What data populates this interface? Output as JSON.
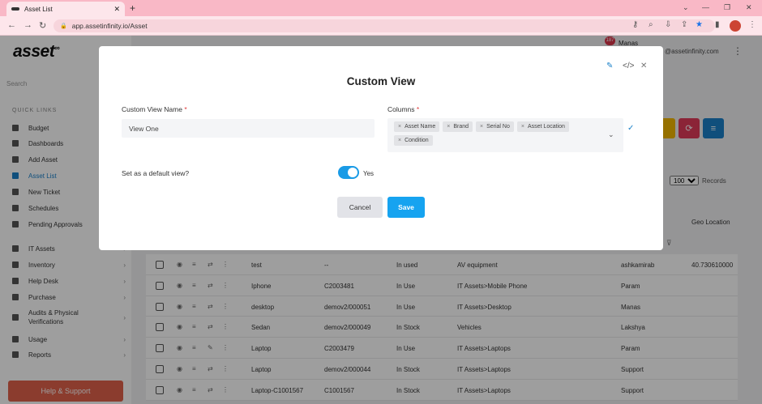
{
  "browser": {
    "tab_title": "Asset List",
    "new_tab": "+",
    "url": "app.assetinfinity.io/Asset"
  },
  "sidebar": {
    "logo": "asset",
    "logo_sup": "∞",
    "search_placeholder": "Search",
    "quick_links_heading": "QUICK LINKS",
    "items": [
      {
        "label": "Budget",
        "icon": "budget-icon"
      },
      {
        "label": "Dashboards",
        "icon": "dashboard-icon"
      },
      {
        "label": "Add Asset",
        "icon": "plus-icon"
      },
      {
        "label": "Asset List",
        "icon": "asset-list-icon",
        "active": true
      },
      {
        "label": "New Ticket",
        "icon": "ticket-icon"
      },
      {
        "label": "Schedules",
        "icon": "calendar-icon"
      },
      {
        "label": "Pending Approvals",
        "icon": "approval-icon"
      },
      {
        "label": "IT Assets",
        "icon": "laptop-icon"
      },
      {
        "label": "Inventory",
        "icon": "inventory-icon"
      },
      {
        "label": "Help Desk",
        "icon": "help-icon"
      },
      {
        "label": "Purchase",
        "icon": "dollar-icon"
      },
      {
        "label": "Audits & Physical Verifications",
        "icon": "audit-icon"
      },
      {
        "label": "Usage",
        "icon": "usage-icon"
      },
      {
        "label": "Reports",
        "icon": "reports-icon"
      }
    ],
    "help_button": "Help & Support"
  },
  "header": {
    "notification_count": "187",
    "user_name": "Manas",
    "user_email": "@assetinfinity.com"
  },
  "list": {
    "records_per_page": "100",
    "records_label": "Records",
    "geo_header": "Geo Location",
    "rows": [
      {
        "name": "test",
        "code": "--",
        "status": "In used",
        "category": "AV equipment",
        "user": "ashkamirab",
        "geo": "40.730610000"
      },
      {
        "name": "Iphone",
        "code": "C2003481",
        "status": "In Use",
        "category": "IT Assets>Mobile Phone",
        "user": "Param",
        "geo": ""
      },
      {
        "name": "desktop",
        "code": "demov2/000051",
        "status": "In Use",
        "category": "IT Assets>Desktop",
        "user": "Manas",
        "geo": ""
      },
      {
        "name": "Sedan",
        "code": "demov2/000049",
        "status": "In Stock",
        "category": "Vehicles",
        "user": "Lakshya",
        "geo": ""
      },
      {
        "name": "Laptop",
        "code": "C2003479",
        "status": "In Use",
        "category": "IT Assets>Laptops",
        "user": "Param",
        "geo": ""
      },
      {
        "name": "Laptop",
        "code": "demov2/000044",
        "status": "In Stock",
        "category": "IT Assets>Laptops",
        "user": "Support",
        "geo": ""
      },
      {
        "name": "Laptop-C1001567",
        "code": "C1001567",
        "status": "In Stock",
        "category": "IT Assets>Laptops",
        "user": "Support",
        "geo": ""
      }
    ]
  },
  "modal": {
    "title": "Custom View",
    "name_label": "Custom View Name",
    "required_mark": "*",
    "name_value": "View One",
    "columns_label": "Columns",
    "columns": [
      "Asset Name",
      "Brand",
      "Serial No",
      "Asset Location",
      "Condition"
    ],
    "default_label": "Set as a default view?",
    "default_value": "Yes",
    "cancel_label": "Cancel",
    "save_label": "Save"
  },
  "colors": {
    "primary": "#16a3f0",
    "accent_blue": "#1a80c9",
    "help_button": "#e0624b",
    "browser_chrome": "#f9b8c6"
  }
}
